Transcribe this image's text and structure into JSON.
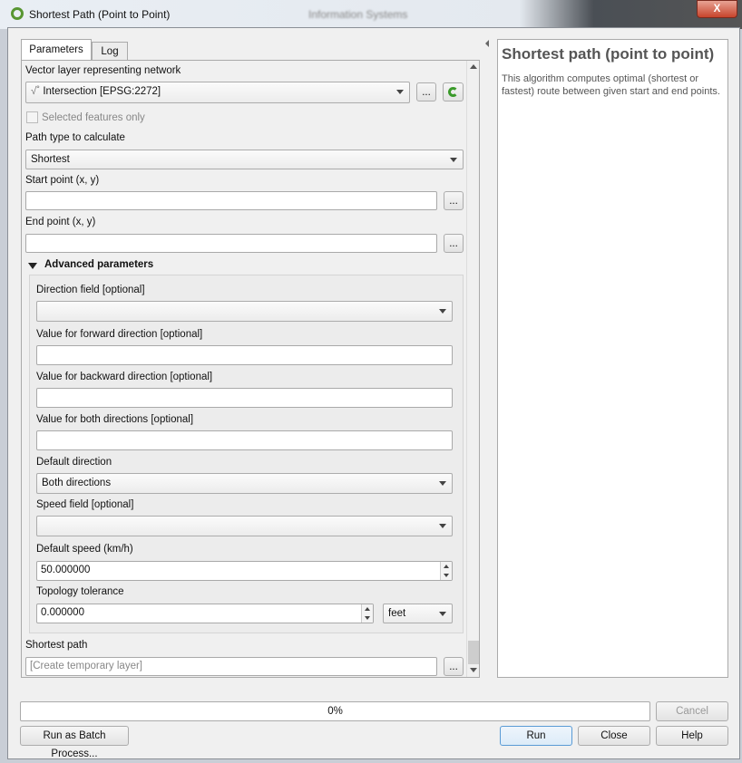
{
  "window": {
    "title": "Shortest Path (Point to Point)",
    "background_title": "Information Systems"
  },
  "tabs": [
    {
      "label": "Parameters",
      "active": true
    },
    {
      "label": "Log",
      "active": false
    }
  ],
  "params": {
    "network_label": "Vector layer representing network",
    "network_value": "Intersection [EPSG:2272]",
    "selected_only": "Selected features only",
    "path_type_label": "Path type to calculate",
    "path_type_value": "Shortest",
    "start_label": "Start point (x, y)",
    "start_value": "",
    "end_label": "End point (x, y)",
    "end_value": "",
    "advanced_label": "Advanced parameters",
    "direction_field_label": "Direction field [optional]",
    "direction_field_value": "",
    "forward_label": "Value for forward direction [optional]",
    "forward_value": "",
    "backward_label": "Value for backward direction [optional]",
    "backward_value": "",
    "both_label": "Value for both directions [optional]",
    "both_value": "",
    "default_direction_label": "Default direction",
    "default_direction_value": "Both directions",
    "speed_field_label": "Speed field [optional]",
    "speed_field_value": "",
    "default_speed_label": "Default speed (km/h)",
    "default_speed_value": "50.000000",
    "tolerance_label": "Topology tolerance",
    "tolerance_value": "0.000000",
    "tolerance_unit": "feet",
    "output_label": "Shortest path",
    "output_placeholder": "[Create temporary layer]",
    "browse": "..."
  },
  "help": {
    "title": "Shortest path (point to point)",
    "text": "This algorithm computes optimal (shortest or fastest) route between given start and end points."
  },
  "progress": {
    "text": "0%",
    "value": 0
  },
  "buttons": {
    "cancel": "Cancel",
    "batch": "Run as Batch Process...",
    "run": "Run",
    "close": "Close",
    "help": "Help",
    "close_x": "X"
  }
}
